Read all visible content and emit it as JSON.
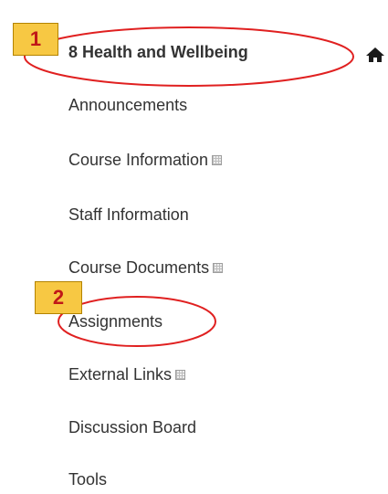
{
  "course": {
    "title": "8 Health and Wellbeing",
    "home_icon": "home-icon"
  },
  "menu": {
    "items": [
      {
        "label": "Announcements",
        "has_icon": false
      },
      {
        "label": "Course Information",
        "has_icon": true
      },
      {
        "label": "Staff Information",
        "has_icon": false
      },
      {
        "label": "Course Documents",
        "has_icon": true
      },
      {
        "label": "Assignments",
        "has_icon": false
      },
      {
        "label": "External Links",
        "has_icon": true
      },
      {
        "label": "Discussion Board",
        "has_icon": false
      },
      {
        "label": "Tools",
        "has_icon": false
      }
    ]
  },
  "annotations": {
    "badge_1": "1",
    "badge_2": "2",
    "color": "#e02020",
    "badge_color": "#f7c843"
  }
}
